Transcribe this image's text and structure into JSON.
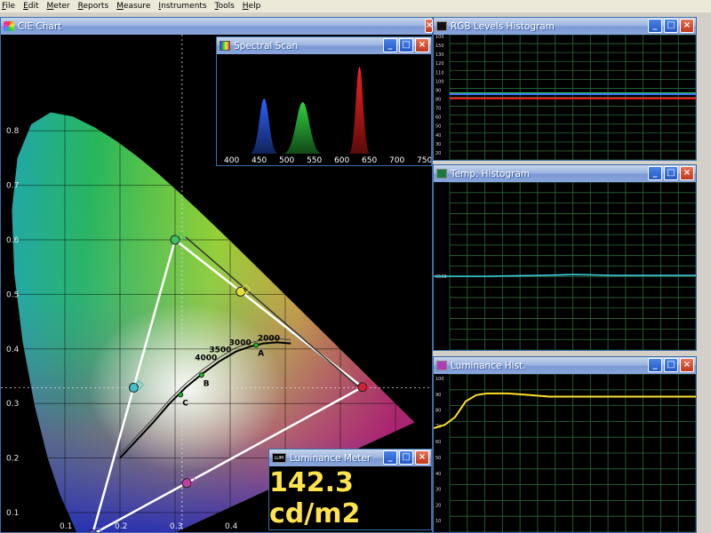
{
  "menu": [
    {
      "label": "File"
    },
    {
      "label": "Edit"
    },
    {
      "label": "Meter"
    },
    {
      "label": "Reports"
    },
    {
      "label": "Measure"
    },
    {
      "label": "Instruments"
    },
    {
      "label": "Tools"
    },
    {
      "label": "Help"
    }
  ],
  "windows": {
    "cie": {
      "title": "CIE Chart"
    },
    "spectral": {
      "title": "Spectral Scan"
    },
    "rgb": {
      "title": "RGB Levels Histogram"
    },
    "temp": {
      "title": "Temp. Histogram"
    },
    "lumhist": {
      "title": "Luminance Hist."
    },
    "lummeter": {
      "title": "Luminance Meter",
      "icon_label": "LUM",
      "value": "142.3 cd/m2"
    }
  },
  "window_buttons": {
    "minimize": "_",
    "maximize": "□",
    "close": "×"
  },
  "cie_chart": {
    "x_ticks": [
      0.1,
      0.2,
      0.3,
      0.4
    ],
    "y_ticks": [
      0.1,
      0.2,
      0.3,
      0.4,
      0.5,
      0.6,
      0.7,
      0.8
    ],
    "cct_labels": [
      "4000",
      "3500",
      "3000",
      "2000"
    ],
    "illuminants": [
      {
        "label": "A",
        "x": 0.447,
        "y": 0.407
      },
      {
        "label": "B",
        "x": 0.348,
        "y": 0.352
      },
      {
        "label": "C",
        "x": 0.31,
        "y": 0.316
      }
    ],
    "gamut": [
      {
        "name": "red",
        "x": 0.64,
        "y": 0.33,
        "color": "#d0203a"
      },
      {
        "name": "green",
        "x": 0.3,
        "y": 0.6,
        "color": "#40c060"
      },
      {
        "name": "blue",
        "x": 0.15,
        "y": 0.06,
        "color": "#5050c8"
      },
      {
        "name": "cyan",
        "x": 0.225,
        "y": 0.329,
        "color": "#40c0c8"
      },
      {
        "name": "magenta",
        "x": 0.321,
        "y": 0.154,
        "color": "#c040a0"
      },
      {
        "name": "yellow",
        "x": 0.419,
        "y": 0.505,
        "color": "#e8e040"
      }
    ],
    "white_point": {
      "x": 0.3127,
      "y": 0.329
    }
  },
  "spectral": {
    "ticks": [
      400,
      450,
      500,
      550,
      600,
      650,
      700,
      750
    ],
    "peaks": [
      {
        "nm": 460,
        "level": 0.62,
        "width": 16,
        "color": "#3060ff"
      },
      {
        "nm": 530,
        "level": 0.58,
        "width": 22,
        "color": "#30d040"
      },
      {
        "nm": 633,
        "level": 0.98,
        "width": 12,
        "color": "#ff2020"
      }
    ]
  },
  "rgb_histogram": {
    "y_labels": [
      "100",
      "150",
      "130",
      "120",
      "110",
      "100",
      "90",
      "80",
      "70",
      "60",
      "50",
      "40",
      "30",
      "20",
      "10"
    ],
    "series": [
      {
        "name": "R",
        "level": 95,
        "color": "#ff2020"
      },
      {
        "name": "G",
        "level": 101,
        "color": "#30d040"
      },
      {
        "name": "B",
        "level": 100,
        "color": "#4070ff"
      }
    ]
  },
  "temp_histogram": {
    "y_label": "6500",
    "level": 6500,
    "color": "#40d8e8"
  },
  "luminance_histogram": {
    "y_labels": [
      "100",
      "90",
      "80",
      "70",
      "60",
      "50",
      "40",
      "30",
      "20",
      "10"
    ],
    "color": "#ffe030",
    "values": [
      73,
      75,
      80,
      90,
      94,
      95,
      95,
      94,
      93,
      93,
      93,
      93,
      93,
      93,
      93,
      93
    ]
  },
  "colors": {
    "accent": "#3a6ea5",
    "grid": "#4a8a4a",
    "readout": "#ffe34d"
  }
}
